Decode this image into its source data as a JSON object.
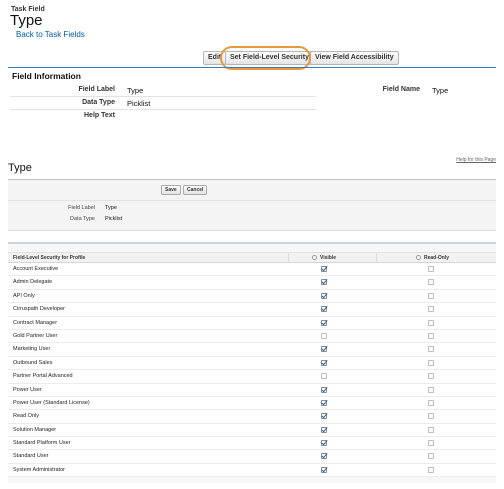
{
  "header": {
    "breadcrumb_label": "Task Field",
    "title": "Type",
    "back_link": "Back to Task Fields"
  },
  "toolbar": {
    "edit_label": "Edit",
    "fls_label": "Set Field-Level Security",
    "accessibility_label": "View Field Accessibility"
  },
  "field_info": {
    "section_title": "Field Information",
    "field_label_label": "Field Label",
    "field_label_value": "Type",
    "data_type_label": "Data Type",
    "data_type_value": "Picklist",
    "help_text_label": "Help Text",
    "field_name_label": "Field Name",
    "field_name_value": "Type"
  },
  "fls_page": {
    "title": "Type",
    "help_link": "Help for this Page",
    "save_label": "Save",
    "cancel_label": "Cancel",
    "field_label_label": "Field Label",
    "field_label_value": "Type",
    "data_type_label": "Data Type",
    "data_type_value": "Picklist"
  },
  "fls_table": {
    "col_profile": "Field-Level Security for Profile",
    "col_visible": "Visible",
    "col_readonly": "Read-Only",
    "rows": [
      {
        "profile": "Account Executive",
        "visible": true,
        "read_only": false
      },
      {
        "profile": "Admin Delegate",
        "visible": true,
        "read_only": false
      },
      {
        "profile": "API Only",
        "visible": true,
        "read_only": false
      },
      {
        "profile": "Cirruspath Developer",
        "visible": true,
        "read_only": false
      },
      {
        "profile": "Contract Manager",
        "visible": true,
        "read_only": false
      },
      {
        "profile": "Gold Partner User",
        "visible": false,
        "read_only": false
      },
      {
        "profile": "Marketing User",
        "visible": true,
        "read_only": false
      },
      {
        "profile": "Outbound Sales",
        "visible": true,
        "read_only": false
      },
      {
        "profile": "Partner Portal Advanced",
        "visible": false,
        "read_only": false
      },
      {
        "profile": "Power User",
        "visible": true,
        "read_only": false
      },
      {
        "profile": "Power User (Standard License)",
        "visible": true,
        "read_only": false
      },
      {
        "profile": "Read Only",
        "visible": true,
        "read_only": false
      },
      {
        "profile": "Solution Manager",
        "visible": true,
        "read_only": false
      },
      {
        "profile": "Standard Platform User",
        "visible": true,
        "read_only": false
      },
      {
        "profile": "Standard User",
        "visible": true,
        "read_only": false
      },
      {
        "profile": "System Administrator",
        "visible": true,
        "read_only": false
      }
    ]
  },
  "colors": {
    "link": "#015ba7",
    "highlight_ring": "#e79a3c",
    "section_bar": "#3a7bbf",
    "checkmark": "#1f5fa8"
  }
}
